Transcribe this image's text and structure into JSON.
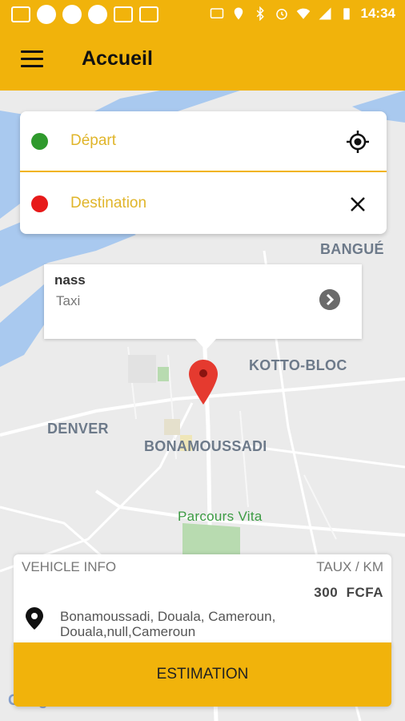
{
  "status_bar": {
    "time": "14:34",
    "left_icons": [
      "notification-icon",
      "circle-icon",
      "circle-icon",
      "circle-icon",
      "sms-icon",
      "gmail-icon"
    ],
    "right_icons": [
      "cast-icon",
      "location-icon",
      "bluetooth-icon",
      "alarm-icon",
      "wifi-icon",
      "signal-icon",
      "battery-icon"
    ]
  },
  "app_bar": {
    "title": "Accueil",
    "menu_icon": "hamburger-menu-icon"
  },
  "search": {
    "departure_placeholder": "Départ",
    "destination_placeholder": "Destination",
    "locate_icon": "gps-target-icon",
    "clear_icon": "close-icon"
  },
  "map": {
    "labels": {
      "bangue": "BANGUÉ",
      "kotto_bloc": "KOTTO-BLOC",
      "denver": "DENVER",
      "bonamoussadi": "BONAMOUSSADI",
      "parcours_vita": "Parcours Vita"
    },
    "attribution": "Google"
  },
  "info_window": {
    "name": "nass",
    "type": "Taxi",
    "arrow_icon": "chevron-right-icon"
  },
  "vehicle_info": {
    "title": "VEHICLE INFO",
    "rate_label": "TAUX / KM",
    "rate_value": "300  FCFA",
    "address_line1": "Bonamoussadi, Douala, Cameroun,",
    "address_line2": "Douala,null,Cameroun",
    "pin_icon": "location-pin-icon"
  },
  "estimate_button": "ESTIMATION",
  "colors": {
    "primary": "#f1b30b",
    "departure_dot": "#2f9a2d",
    "destination_dot": "#e71a1a",
    "placeholder": "#e0b52a"
  }
}
